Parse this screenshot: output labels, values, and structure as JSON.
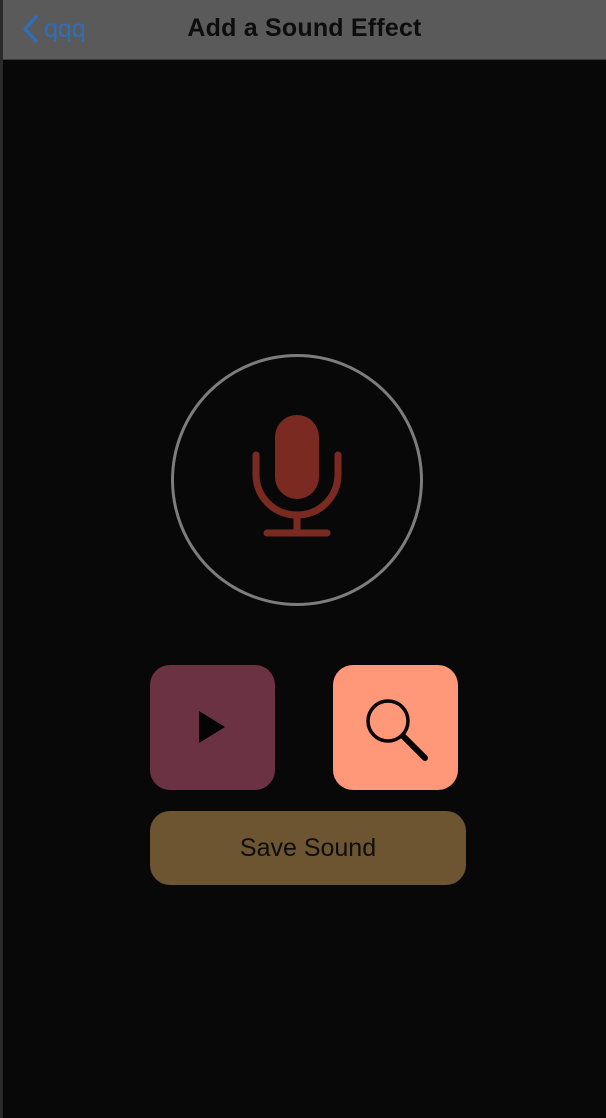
{
  "nav": {
    "back_label": "qqq",
    "title": "Add a Sound Effect"
  },
  "record": {
    "icon": "microphone-icon",
    "icon_color": "#7b2a22",
    "ring_color": "#7d7d7d"
  },
  "play": {
    "icon": "play-icon",
    "bg_color": "#6a3242"
  },
  "search": {
    "icon": "magnifier-icon",
    "bg_color": "#ff9779"
  },
  "save": {
    "label": "Save Sound",
    "bg_color": "#6d5532"
  },
  "colors": {
    "background": "#080808",
    "navbar": "#5a5a5a",
    "link": "#2f6fb8"
  }
}
